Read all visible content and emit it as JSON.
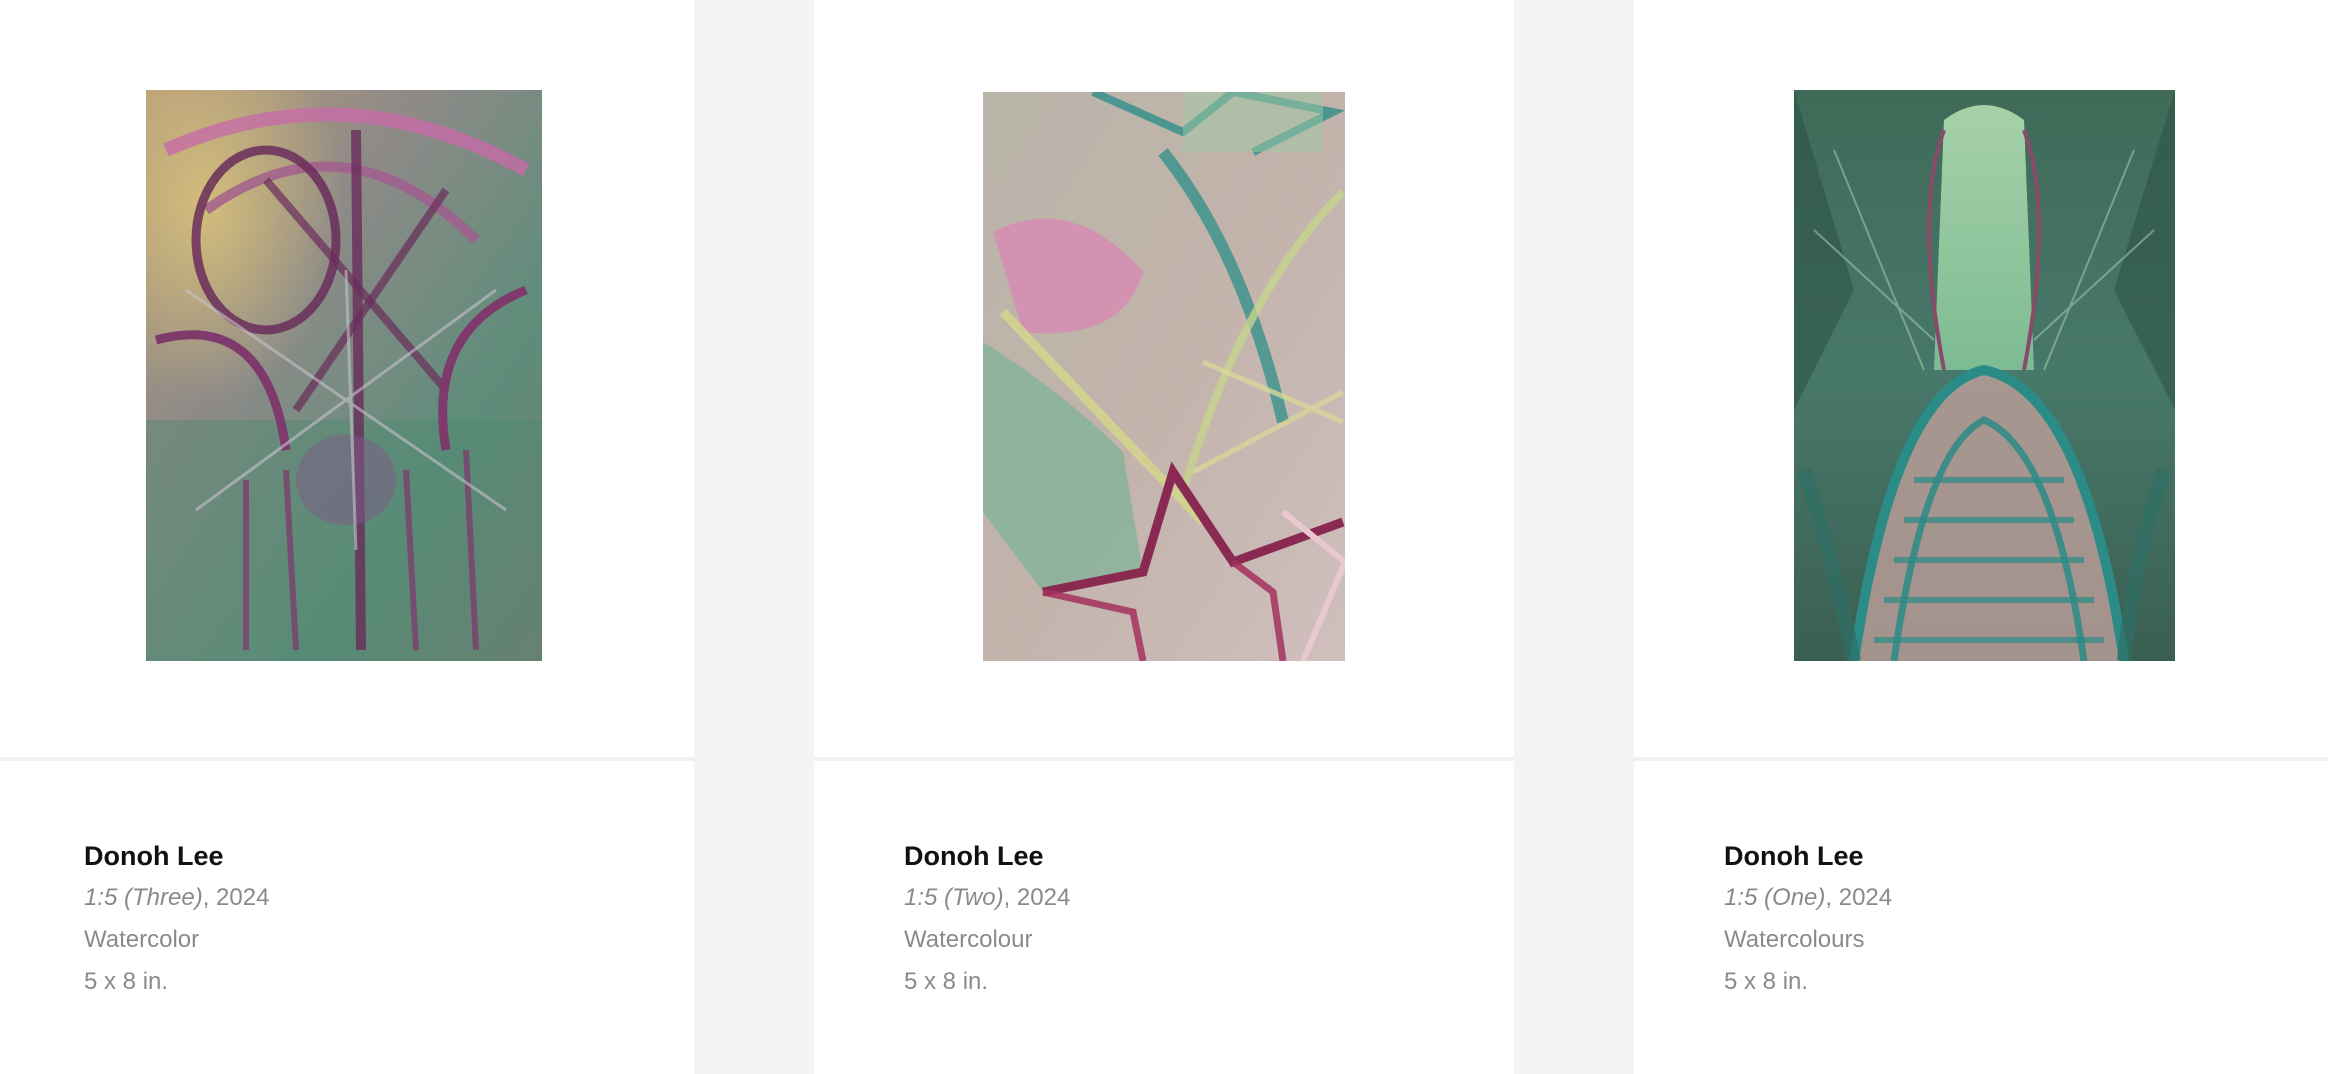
{
  "artworks": [
    {
      "artist": "Donoh Lee",
      "title": "1:5 (Three)",
      "year_text": ", 2024",
      "medium": "Watercolor",
      "dimensions": "5 x 8 in.",
      "palette": [
        "#8d8a86",
        "#b86aa1",
        "#6a2d5b",
        "#3f8f77",
        "#c7b36a",
        "#a5a5a3"
      ]
    },
    {
      "artist": "Donoh Lee",
      "title": "1:5 (Two)",
      "year_text": ", 2024",
      "medium": "Watercolour",
      "dimensions": "5 x 8 in.",
      "palette": [
        "#bdb2a6",
        "#d889b3",
        "#2e8f8a",
        "#8a2a52",
        "#d3d48e",
        "#78b49a"
      ]
    },
    {
      "artist": "Donoh Lee",
      "title": "1:5 (One)",
      "year_text": ", 2024",
      "medium": "Watercolours",
      "dimensions": "5 x 8 in.",
      "palette": [
        "#3f6a58",
        "#2b8b86",
        "#9fd7a8",
        "#8a4b6a",
        "#b79c98",
        "#2f4f45"
      ]
    }
  ]
}
